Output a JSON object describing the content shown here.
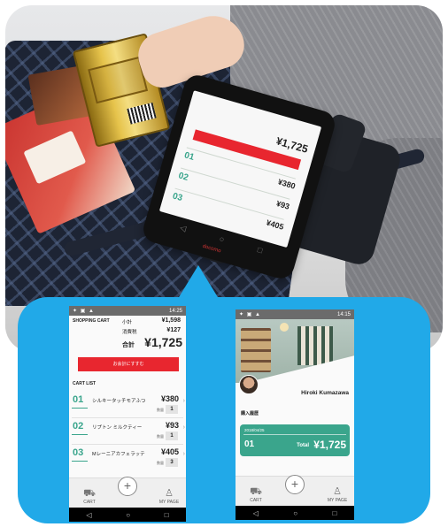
{
  "left_screen": {
    "status_time": "14:25",
    "title": "SHOPPING CART",
    "subtotal_label": "小計",
    "subtotal_value": "¥1,598",
    "tax_label": "消費税",
    "tax_value": "¥127",
    "total_label": "合計",
    "total_value": "¥1,725",
    "checkout_label": "お会計にすすむ",
    "cart_list_label": "CART LIST",
    "qty_label": "数量",
    "items": [
      {
        "num": "01",
        "name": "シルキータッチモアふつ",
        "price": "¥380",
        "qty": "1"
      },
      {
        "num": "02",
        "name": "リプトン ミルクティー",
        "price": "¥93",
        "qty": "1"
      },
      {
        "num": "03",
        "name": "Mレーニアカフェラッテ",
        "price": "¥405",
        "qty": "3"
      }
    ],
    "tab_cart": "CART",
    "tab_mypage": "MY PAGE"
  },
  "right_screen": {
    "status_time": "14:15",
    "user_name": "Hiroki Kumazawa",
    "history_label": "購入履歴",
    "history_date": "2018/04/25",
    "history_num": "01",
    "history_total_label": "Total",
    "history_total": "¥1,725",
    "tab_cart": "CART",
    "tab_mypage": "MY PAGE"
  },
  "photo_device": {
    "total": "¥1,725",
    "rows": [
      {
        "num": "01",
        "price": "¥380"
      },
      {
        "num": "02",
        "price": "¥93"
      },
      {
        "num": "03",
        "price": "¥405"
      }
    ],
    "brand": "docomo"
  },
  "icons": {
    "cart": "cart-icon",
    "add": "plus-circle-icon",
    "mypage": "person-icon",
    "back": "nav-back-icon",
    "home": "nav-home-icon",
    "recent": "nav-recent-icon"
  },
  "colors": {
    "accent_blue": "#21a9e8",
    "checkout_red": "#e8262f",
    "teal": "#3aa58c"
  }
}
